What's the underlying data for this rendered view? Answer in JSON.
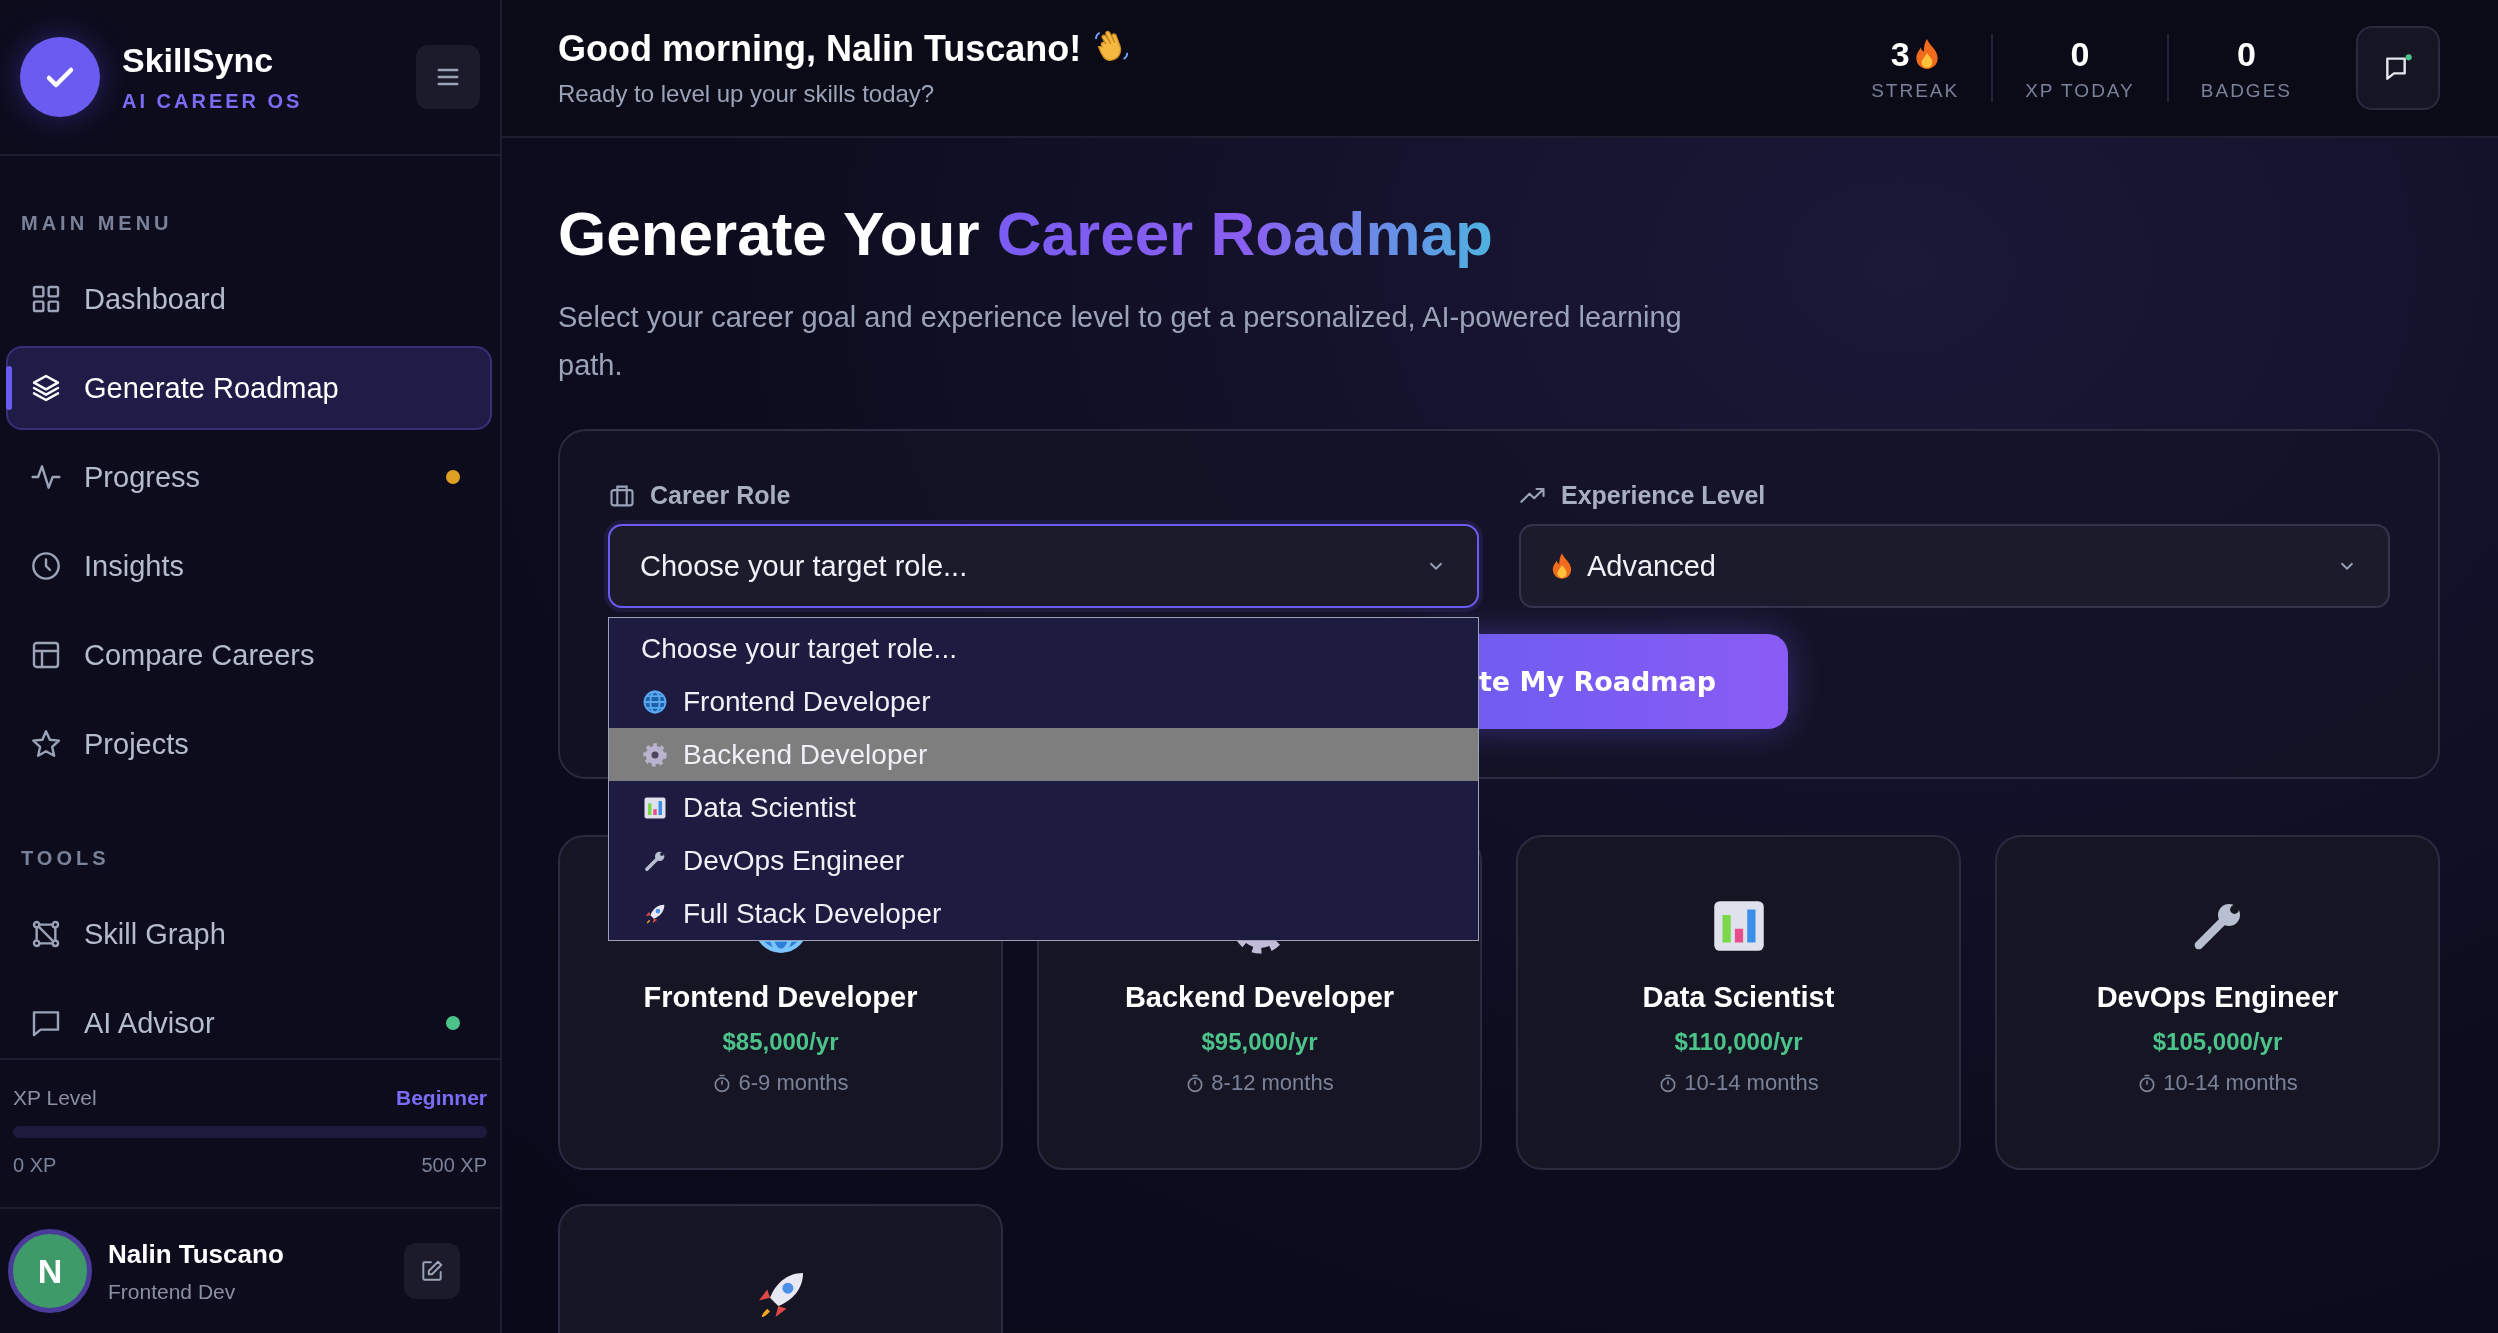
{
  "sidebar": {
    "brand": {
      "name": "SkillSync",
      "tagline": "AI CAREER OS"
    },
    "sections": [
      {
        "title": "MAIN MENU",
        "items": [
          {
            "kind": "grid",
            "label": "Dashboard",
            "selected": false
          },
          {
            "kind": "layers",
            "label": "Generate Roadmap",
            "selected": true
          },
          {
            "kind": "pulse",
            "label": "Progress",
            "selected": false,
            "color": "#e0a024"
          },
          {
            "kind": "clock",
            "label": "Insights",
            "selected": false
          },
          {
            "kind": "table",
            "label": "Compare Careers",
            "selected": false
          },
          {
            "kind": "star",
            "label": "Projects",
            "selected": false
          }
        ]
      },
      {
        "title": "TOOLS",
        "items": [
          {
            "kind": "graph",
            "label": "Skill Graph",
            "selected": false
          },
          {
            "kind": "chat",
            "label": "AI Advisor",
            "selected": false,
            "color": "#4cc38a"
          }
        ]
      }
    ],
    "xp": {
      "label": "XP Level",
      "rank": "Beginner",
      "level": 0,
      "min": "0 XP",
      "max": "500 XP"
    },
    "user": {
      "initial": "N",
      "name": "Nalin Tuscano",
      "role": "Frontend Dev"
    }
  },
  "header": {
    "greeting": "Good morning, Nalin Tuscano!",
    "subtitle": "Ready to level up your skills today?",
    "stats": [
      {
        "value": "3",
        "label": "STREAK",
        "flame": true
      },
      {
        "value": "0",
        "label": "XP TODAY",
        "flame": false
      },
      {
        "value": "0",
        "label": "BADGES",
        "flame": false
      }
    ]
  },
  "hero": {
    "title": "Generate Your",
    "highlight": "Career Roadmap",
    "description": "Select your career goal and experience level to get a personalized, AI-powered learning path."
  },
  "form": {
    "career_role": {
      "label": "Career Role",
      "value": "Choose your target role...",
      "expanded": true,
      "options": [
        {
          "kind": "none",
          "label": "Choose your target role...",
          "highlighted": false
        },
        {
          "kind": "globe",
          "label": "Frontend Developer",
          "highlighted": false
        },
        {
          "kind": "gear",
          "label": "Backend Developer",
          "highlighted": true
        },
        {
          "kind": "chart",
          "label": "Data Scientist",
          "highlighted": false
        },
        {
          "kind": "wrench",
          "label": "DevOps Engineer",
          "highlighted": false
        },
        {
          "kind": "rocket",
          "label": "Full Stack Developer",
          "highlighted": false
        }
      ]
    },
    "experience_level": {
      "label": "Experience Level",
      "value": "Advanced"
    },
    "button": "te My Roadmap"
  },
  "careers": [
    {
      "kind": "globe",
      "name": "Frontend Developer",
      "salary": "$85,000/yr",
      "duration": "6-9 months"
    },
    {
      "kind": "gear",
      "name": "Backend Developer",
      "salary": "$95,000/yr",
      "duration": "8-12 months"
    },
    {
      "kind": "chart",
      "name": "Data Scientist",
      "salary": "$110,000/yr",
      "duration": "10-14 months"
    },
    {
      "kind": "wrench",
      "name": "DevOps Engineer",
      "salary": "$105,000/yr",
      "duration": "10-14 months"
    },
    {
      "kind": "rocket"
    }
  ]
}
